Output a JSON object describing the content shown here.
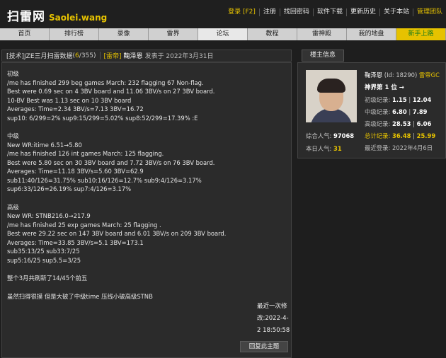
{
  "site": {
    "logo": "扫雷网",
    "logo_sub": "Saolei.wang"
  },
  "topnav": [
    "登录 [F2]",
    "注册",
    "找回密码",
    "软件下载",
    "更新历史",
    "关于本站",
    "管理团队"
  ],
  "mainnav": [
    "首页",
    "排行榜",
    "录像",
    "雷界",
    "论坛",
    "教程",
    "雷神殿",
    "我的地盘",
    "新手上路"
  ],
  "thread": {
    "title": "[技术]JZE三月扫雷数据",
    "count_open": "(",
    "count_cur": "6",
    "count_rest": "/355)",
    "tag": "[雷帝]",
    "author": "鞠泽恩",
    "posted": "发表于 2022年3月31日"
  },
  "post": {
    "lines": [
      "初级",
      "/me has finished 299 beg games March: 232 flagging 67 Non-flag.",
      "Best were 0.69 sec on 4 3BV board and 11.06 3BV/s on 27 3BV board.",
      "10-BV  Best was 1.13 sec on 10 3BV board",
      "Averages: Time=2.34 3BV/s=7.13 3BV=16.72",
      "sup10: 6/299=2% sup9:15/299=5.02% sup8:52/299=17.39% :E",
      "",
      "中级",
      "New WR:itime 6.51→5.80",
      "/me has finished 126 int games March: 125 flagging.",
      "Best were 5.80 sec on 30 3BV board and 7.72 3BV/s on 76 3BV board.",
      "Averages: Time=11.18 3BV/s=5.60 3BV=62.9",
      "sub11:40/126=31.75% sub10:16/126=12.7% sub9:4/126=3.17%",
      "sup6:33/126=26.19% sup7:4/126=3.17%",
      "",
      "高级",
      "New WR: STNB216.0→217.9",
      "/me has finished 25 exp games March: 25 flagging .",
      " Best were 29.22 sec on 147 3BV board and 6.01 3BV/s on 209 3BV board.",
      "Averages: Time=33.85 3BV/s=5.1 3BV=173.1",
      "sub35:13/25 sub33:7/25",
      "sup5:16/25 sup5.5=3/25",
      "",
      "整个3月共刷新了14/45个前五",
      "",
      "虽然扫得很摸 但是大破了中级time 压线小破高级STNB"
    ],
    "lastmod_1": "最近一次修",
    "lastmod_2": "改:2022-4-",
    "lastmod_3": "2 18:50:58",
    "reply_button": "回复此主题"
  },
  "sidebar": {
    "tab": "楼主信息",
    "username": "鞠泽恩",
    "user_id": "(Id: 18290)",
    "title": "雷帝GC",
    "rank": "神界第 1 位 →",
    "records": [
      {
        "label": "初级纪录:",
        "time": "1.15",
        "speed": "12.04"
      },
      {
        "label": "中级纪录:",
        "time": "6.80",
        "speed": "7.89"
      },
      {
        "label": "高级纪录:",
        "time": "28.53",
        "speed": "6.06"
      },
      {
        "label": "总计纪录:",
        "time": "36.48",
        "speed": "25.99"
      }
    ],
    "last_login_label": "最近登录:",
    "last_login": "2022年4月6日",
    "pop_total_label": "综合人气:",
    "pop_total": "97068",
    "pop_today_label": "本日人气:",
    "pop_today": "31"
  },
  "colors": {
    "accent": "#e6c200",
    "nav_bg": "#d0d0d0",
    "panel_bg": "#2b2b2b",
    "page_bg": "#1e1e1e"
  }
}
